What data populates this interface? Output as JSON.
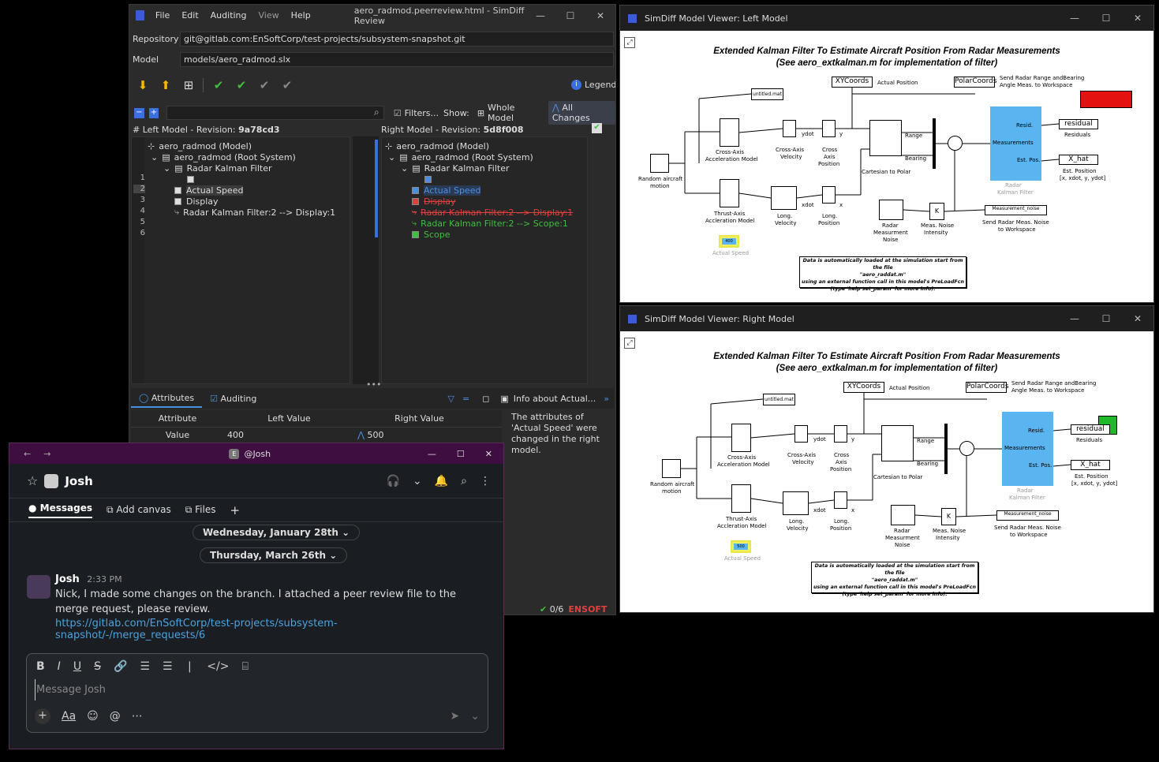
{
  "main": {
    "menu": [
      "File",
      "Edit",
      "Auditing",
      "View",
      "Help"
    ],
    "title": "aero_radmod.peerreview.html - SimDiff Review",
    "repo_label": "Repository",
    "repo_value": "git@gitlab.com:EnSoftCorp/test-projects/subsystem-snapshot.git",
    "model_label": "Model",
    "model_value": "models/aero_radmod.slx",
    "legend": "Legend",
    "filters": "Filters...",
    "show": "Show:",
    "whole_model": "Whole Model",
    "all_changes": "All Changes",
    "left_header_prefix": "# Left Model - Revision: ",
    "left_rev": "9a78cd3",
    "right_header_prefix": "Right Model - Revision: ",
    "right_rev": "5d8f008",
    "left_tree": [
      "aero_radmod (Model)",
      "aero_radmod (Root System)",
      "Radar Kalman Filter",
      "Actual Speed",
      "Display",
      "Radar Kalman Filter:2 --> Display:1"
    ],
    "right_tree": [
      "aero_radmod (Model)",
      "aero_radmod (Root System)",
      "Radar Kalman Filter",
      "Actual Speed",
      "Display",
      "Radar Kalman Filter:2 --> Display:1",
      "Radar Kalman Filter:2 --> Scope:1",
      "Scope"
    ],
    "line_numbers": [
      "1",
      "2",
      "3",
      "4",
      "5",
      "6"
    ],
    "tab_attributes": "Attributes",
    "tab_auditing": "Auditing",
    "info_title": "Info about Actual...",
    "col_attribute": "Attribute",
    "col_left": "Left Value",
    "col_right": "Right Value",
    "row_attr": "Value",
    "row_left": "400",
    "row_right": "500",
    "info_text": "The attributes of 'Actual Speed' were changed in the right model.",
    "status_count": "0/6",
    "brand": "ENSOFT",
    "colors": {
      "accent": "#3b5bdb",
      "added": "#3fbf3f",
      "removed": "#e04040",
      "changed": "#4a90e2"
    }
  },
  "viewer_left": {
    "title": "SimDiff Model Viewer: Left Model",
    "actual_speed_value": "400"
  },
  "viewer_right": {
    "title": "SimDiff Model Viewer: Right Model",
    "actual_speed_value": "500"
  },
  "diagram": {
    "title1": "Extended Kalman Filter To Estimate Aircraft Position From Radar Measurements",
    "title2": "(See aero_extkalman.m for implementation of filter)",
    "untitled": "untitled.mat",
    "xycoords": "XYCoords",
    "actual_position": "Actual Position",
    "polarcoords": "PolarCoords",
    "send_radar": "Send Radar Range andBearing",
    "angle_meas": "Angle Meas. to Workspace",
    "residual": "residual",
    "residuals": "Residuals",
    "xhat": "X_hat",
    "est_position": "Est. Position",
    "est_vec": "[x, xdot, y, ydot]",
    "resid": "Resid.",
    "measurements": "Measurements",
    "est_pos": "Est. Pos.",
    "radar": "Radar",
    "kalman_filter": "Kalman Filter",
    "cross_axis_accel": "Cross-Axis",
    "accel_model": "Acceleration Model",
    "cross_axis_vel": "Cross-Axis",
    "velocity": "Velocity",
    "cross": "Cross",
    "axis": "Axis",
    "position": "Position",
    "ydot": "ydot",
    "y": "y",
    "xdot": "xdot",
    "x": "x",
    "range": "Range",
    "bearing": "Bearing",
    "cart_polar": "Cartesian to Polar",
    "random": "Random aircraft",
    "motion": "motion",
    "thrust": "Thrust-Axis",
    "thrust_model": "Accleration Model",
    "long": "Long.",
    "long_vel": "Velocity",
    "long_pos": "Position",
    "radar_meas": "Radar",
    "measurment": "Measurment",
    "noise": "Noise",
    "meas_noise": "Meas. Noise",
    "intensity": "Intensity",
    "k": "K",
    "meas_noise_blk": "Measurement_noise",
    "send_noise": "Send Radar Meas. Noise",
    "to_ws": "to Workspace",
    "actual_speed": "Actual Speed",
    "note1": "Data is automatically loaded at the simulation start from the file",
    "note2": "\"aero_raddat.m\"",
    "note3": "using an external function call in this model's PreLoadFcn",
    "note4": "(type 'help set_param' for more info)."
  },
  "chat": {
    "title": "@Josh",
    "user": "Josh",
    "tabs": [
      "Messages",
      "Add canvas",
      "Files"
    ],
    "date1": "Wednesday, January 28th",
    "date2": "Thursday, March 26th",
    "sender": "Josh",
    "time": "2:33 PM",
    "message": "Nick, I made some changes on the branch. I attached a peer review file to the merge request, please review.",
    "link": "https://gitlab.com/EnSoftCorp/test-projects/subsystem-snapshot/-/merge_requests/6",
    "placeholder": "Message Josh",
    "format_aa": "Aa"
  }
}
